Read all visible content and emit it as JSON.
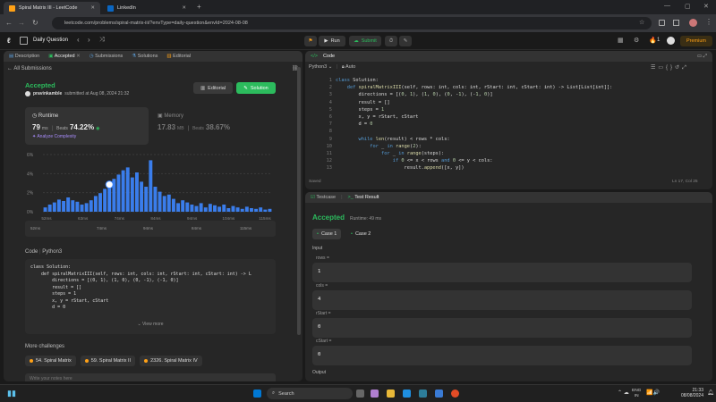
{
  "browser": {
    "tabs": [
      {
        "title": "Spiral Matrix III - LeetCode",
        "active": true
      },
      {
        "title": "LinkedIn",
        "active": false
      }
    ],
    "url": "leetcode.com/problems/spiral-matrix-iii/?envType=daily-question&envId=2024-08-08"
  },
  "header": {
    "daily_label": "Daily Question",
    "run_label": "Run",
    "submit_label": "Submit",
    "streak": "1",
    "premium_label": "Premium"
  },
  "left": {
    "tabs": [
      "Description",
      "Accepted",
      "Submissions",
      "Solutions",
      "Editorial"
    ],
    "all_submissions": "All Submissions",
    "status": "Accepted",
    "user": "pravinkamble",
    "submitted": "submitted at Aug 08, 2024 21:32",
    "editorial_btn": "Editorial",
    "solution_btn": "Solution",
    "runtime_label": "Runtime",
    "runtime_value": "79",
    "runtime_unit": "ms",
    "beats_label": "Beats",
    "runtime_beats": "74.22%",
    "analyze": "Analyze Complexity",
    "memory_label": "Memory",
    "memory_value": "17.83",
    "memory_unit": "MB",
    "memory_beats": "38.67%",
    "code_label": "Code",
    "code_lang": "Python3",
    "code_preview": [
      "class Solution:",
      "    def spiralMatrixIII(self, rows: int, cols: int, rStart: int, cStart: int) -> L",
      "        directions = [(0, 1), (1, 0), (0, -1), (-1, 0)]",
      "        result = []",
      "        steps = 1",
      "        x, y = rStart, cStart",
      "        d = 0"
    ],
    "view_more": "View more",
    "more_challenges": "More challenges",
    "challenges": [
      "54. Spiral Matrix",
      "59. Spiral Matrix II",
      "2326. Spiral Matrix IV"
    ],
    "notes_placeholder": "Write your notes here"
  },
  "chart_data": {
    "type": "bar",
    "title": "",
    "yticks": [
      "6%",
      "4%",
      "2%",
      "0%"
    ],
    "xticks": [
      "52ms",
      "63ms",
      "74ms",
      "84ms",
      "94ms",
      "104ms",
      "115ms"
    ],
    "ylim": [
      0,
      8
    ],
    "values": [
      0.6,
      1,
      1.3,
      1.7,
      1.5,
      2,
      1.6,
      1.4,
      1,
      1.2,
      1.6,
      2.2,
      2.6,
      3.2,
      3.8,
      4.6,
      5.2,
      5.8,
      6.2,
      4.8,
      5.5,
      4.2,
      3.5,
      7.2,
      3.5,
      2.8,
      2.2,
      2.4,
      1.8,
      1.2,
      1.6,
      1.3,
      1,
      0.8,
      1.2,
      0.6,
      1.1,
      0.9,
      0.7,
      1,
      0.5,
      0.8,
      0.6,
      0.4,
      0.7,
      0.5,
      0.4,
      0.6,
      0.3,
      0.4
    ],
    "highlight_index": 14,
    "mini_labels": [
      "52ms",
      "74ms",
      "94ms",
      "84ms",
      "115ms"
    ]
  },
  "editor": {
    "title": "Code",
    "lang": "Python3",
    "auto": "Auto",
    "lines": [
      "class Solution:",
      "    def spiralMatrixIII(self, rows: int, cols: int, rStart: int, cStart: int) -> List[List[int]]:",
      "        directions = [(0, 1), (1, 0), (0, -1), (-1, 0)]",
      "        result = []",
      "        steps = 1",
      "        x, y = rStart, cStart",
      "        d = 0",
      "",
      "        while len(result) < rows * cols:",
      "            for _ in range(2):",
      "                for _ in range(steps):",
      "                    if 0 <= x < rows and 0 <= y < cols:",
      "                        result.append([x, y])"
    ],
    "saved": "Saved",
    "cursor": "Ln 17, Col 25"
  },
  "testpanel": {
    "tabs": [
      "Testcase",
      "Test Result"
    ],
    "status": "Accepted",
    "runtime": "Runtime: 49 ms",
    "cases": [
      "Case 1",
      "Case 2"
    ],
    "input_label": "Input",
    "fields": [
      {
        "name": "rows =",
        "value": "1"
      },
      {
        "name": "cols =",
        "value": "4"
      },
      {
        "name": "rStart =",
        "value": "0"
      },
      {
        "name": "cStart =",
        "value": "0"
      }
    ],
    "output_label": "Output"
  },
  "taskbar": {
    "search": "Search",
    "lang1": "ENG",
    "lang2": "IN",
    "time": "21:33",
    "date": "08/08/2024"
  }
}
